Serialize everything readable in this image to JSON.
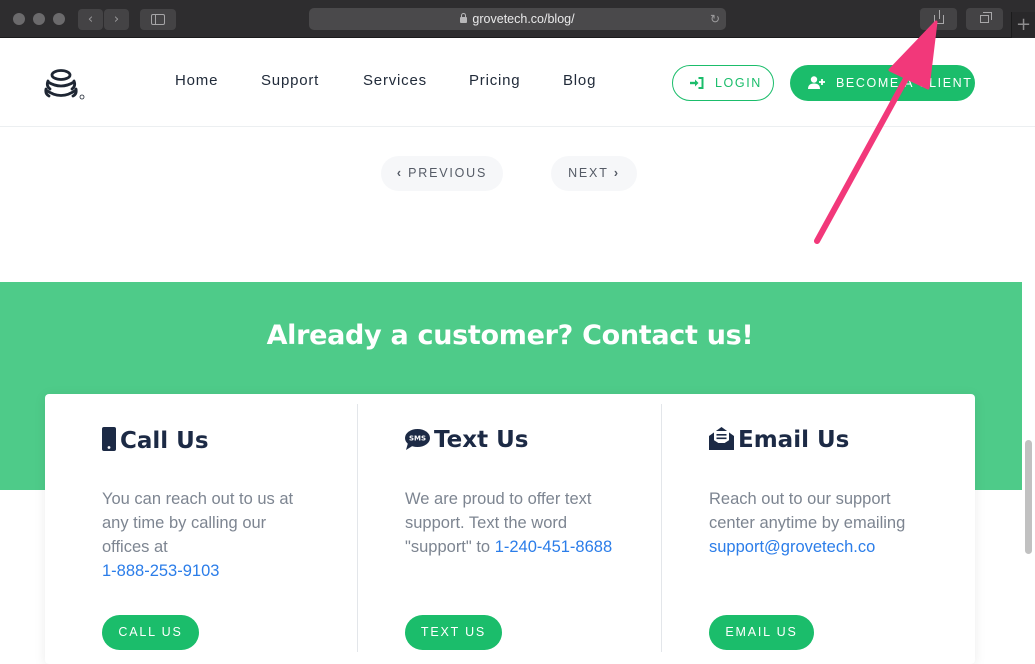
{
  "browser": {
    "url": "grovetech.co/blog/",
    "new_tab_symbol": "+"
  },
  "header": {
    "nav": [
      "Home",
      "Support",
      "Services",
      "Pricing",
      "Blog"
    ],
    "login_label": "LOGIN",
    "client_label": "BECOME A CLIENT",
    "brand_color": "#1bbd6b"
  },
  "pager": {
    "previous_label": "PREVIOUS",
    "next_label": "NEXT"
  },
  "contact": {
    "title": "Already a customer? Contact us!",
    "band_color": "#4ecb89",
    "columns": [
      {
        "icon": "mobile-phone-icon",
        "title": "Call Us",
        "text": "You can reach out to us at any time by calling our offices at",
        "link": "1-888-253-9103",
        "button": "CALL US"
      },
      {
        "icon": "sms-bubble-icon",
        "title": "Text Us",
        "text": "We are proud to offer text support. Text the word \"support\" to",
        "link": "1-240-451-8688",
        "button": "TEXT US"
      },
      {
        "icon": "envelope-open-icon",
        "title": "Email Us",
        "text": "Reach out to our support center anytime by emailing",
        "link": "support@grovetech.co",
        "button": "EMAIL US"
      }
    ]
  },
  "annotation": {
    "arrow_color": "#f2387a",
    "points_to": "share-button"
  }
}
